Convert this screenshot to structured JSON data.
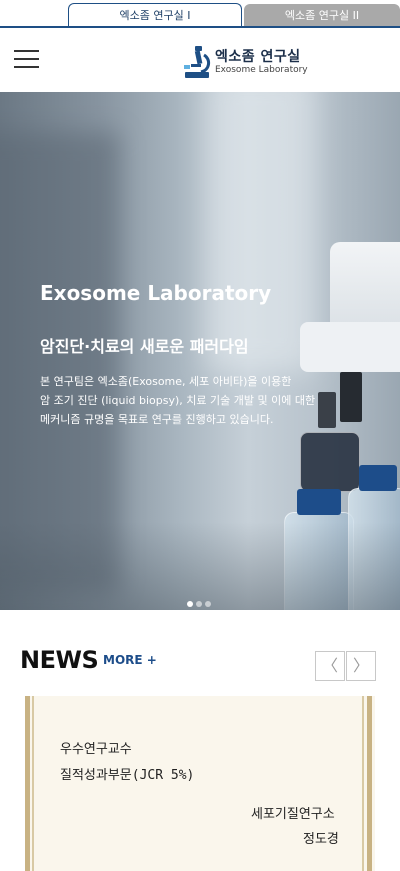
{
  "lab_tabs": [
    {
      "label": "엑소좀 연구실 I",
      "active": true
    },
    {
      "label": "엑소좀 연구실 II",
      "active": false
    }
  ],
  "header": {
    "menu_icon": "hamburger-menu-icon",
    "logo_icon": "microscope-icon",
    "logo_title": "엑소좀 연구실",
    "logo_subtitle": "Exosome Laboratory"
  },
  "hero": {
    "title": "Exosome Laboratory",
    "subtitle": "암진단·치료의 새로운 패러다임",
    "description_lines": [
      "본 연구팀은 엑소좀(Exosome, 세포 아비타)을 이용한",
      "암 조기 진단 (liquid biopsy), 치료 기술 개발 및 이에 대한",
      "메커니즘 규명을 목표로 연구를 진행하고 있습니다."
    ],
    "slide_count": 3,
    "active_slide": 1
  },
  "news": {
    "title": "NEWS",
    "more_label": "MORE +",
    "prev_glyph": "〈",
    "next_glyph": "〉",
    "certificate_lines": [
      "우수연구교수",
      "질적성과부문(JCR 5%)",
      "세포기질연구소",
      "정도경"
    ]
  },
  "colors": {
    "brand_navy": "#1e4f85",
    "inactive_tab": "#a9a9a9",
    "more_link": "#1d4d8a"
  }
}
